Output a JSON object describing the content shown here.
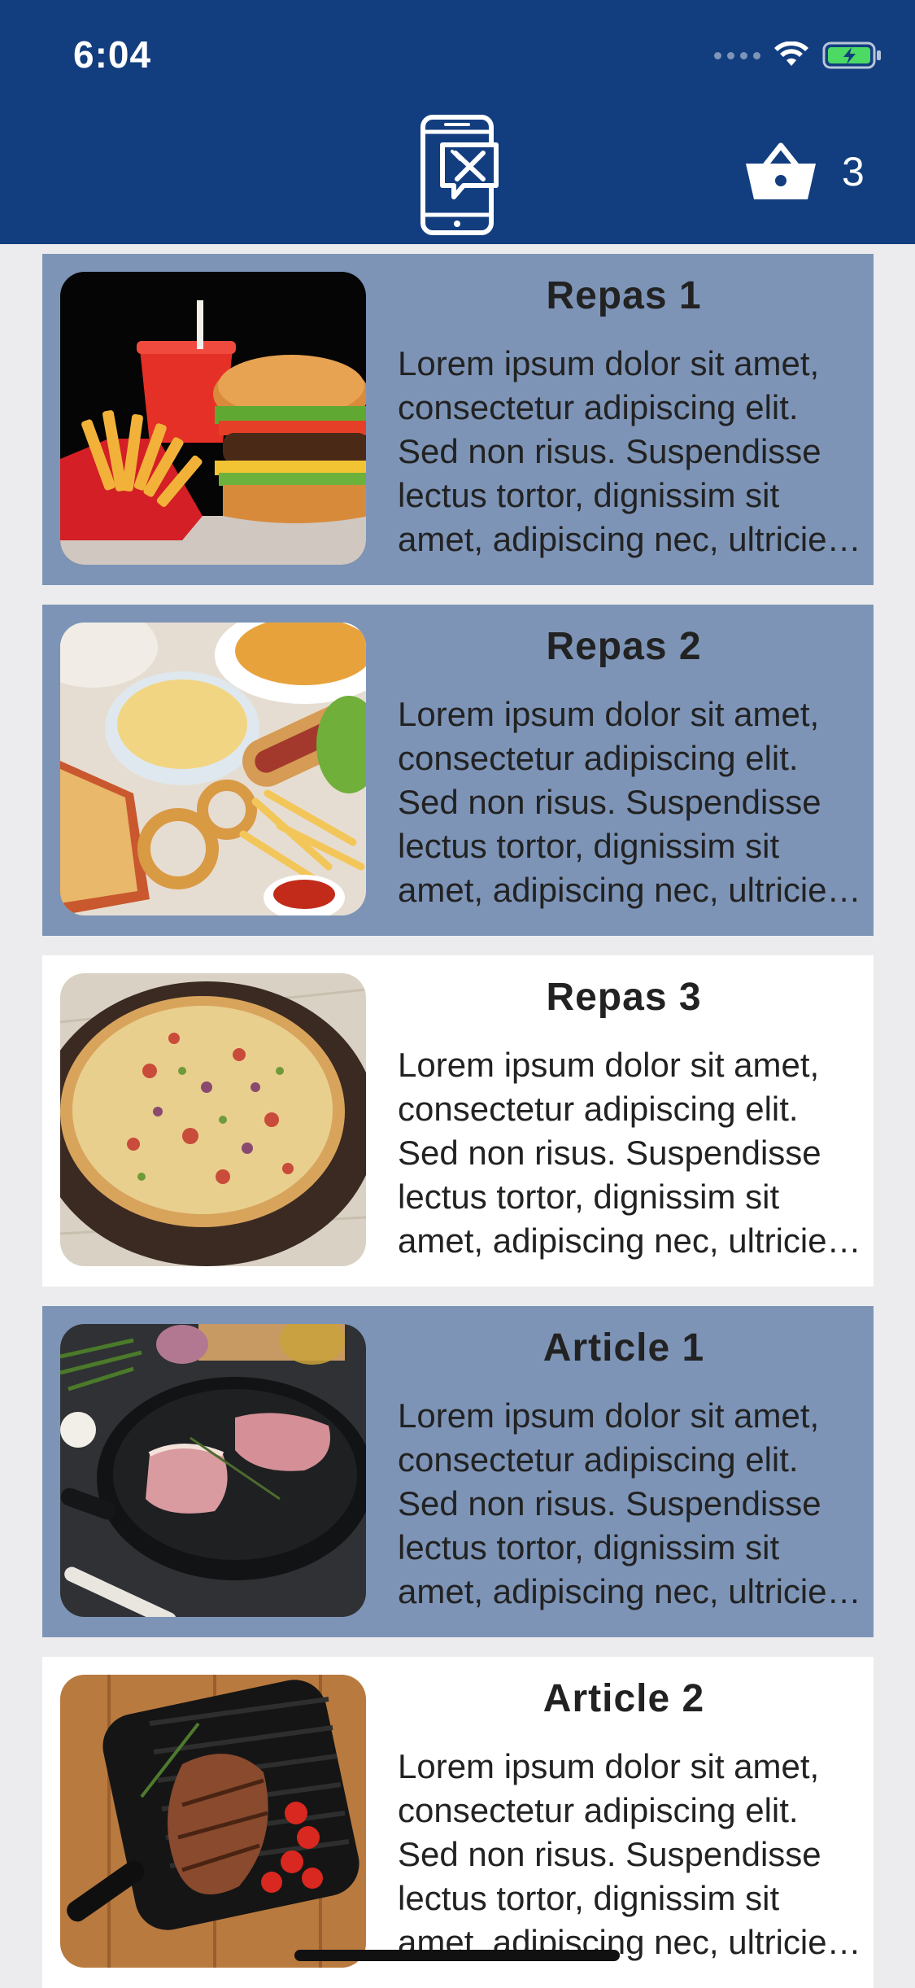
{
  "status_bar": {
    "time": "6:04",
    "icons": [
      "signal-dots-icon",
      "wifi-icon",
      "battery-charging-icon"
    ]
  },
  "header": {
    "logo_icon": "phone-restaurant-logo-icon",
    "cart_icon": "basket-icon",
    "cart_count": "3",
    "background_color": "#123e7f"
  },
  "items": [
    {
      "title": "Repas 1",
      "description": "Lorem ipsum dolor sit amet, consectetur adipiscing elit. Sed non risus. Suspendisse lectus tortor, dignissim sit amet, adipiscing nec, ultricies sed, dolor.",
      "image": "burger-and-fries",
      "highlighted": true
    },
    {
      "title": "Repas 2",
      "description": "Lorem ipsum dolor sit amet, consectetur adipiscing elit. Sed non risus. Suspendisse lectus tortor, dignissim sit amet, adipiscing nec, ultricies sed, dolor.",
      "image": "fast-food-platter",
      "highlighted": true
    },
    {
      "title": "Repas 3",
      "description": "Lorem ipsum dolor sit amet, consectetur adipiscing elit. Sed non risus. Suspendisse lectus tortor, dignissim sit amet, adipiscing nec, ultricies sed, dolor.",
      "image": "pizza",
      "highlighted": false
    },
    {
      "title": "Article 1",
      "description": "Lorem ipsum dolor sit amet, consectetur adipiscing elit. Sed non risus. Suspendisse lectus tortor, dignissim sit amet, adipiscing nec, ultricies sed, dolor.",
      "image": "meat-in-pan",
      "highlighted": true
    },
    {
      "title": "Article 2",
      "description": "Lorem ipsum dolor sit amet, consectetur adipiscing elit. Sed non risus. Suspendisse lectus tortor, dignissim sit amet, adipiscing nec, ultricies sed, dolor.",
      "image": "steak-on-grill-pan",
      "highlighted": false
    }
  ],
  "colors": {
    "highlight_card": "#7d94b7",
    "plain_card": "#ffffff",
    "page_background": "#ececee",
    "text": "#222222"
  }
}
